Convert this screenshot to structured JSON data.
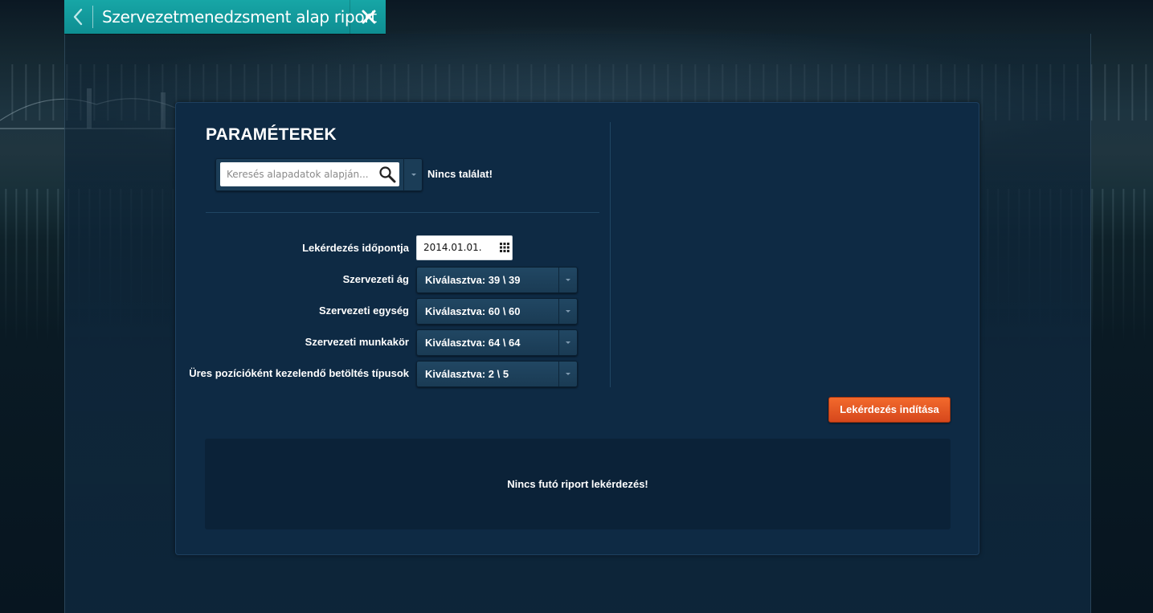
{
  "window": {
    "title": "Szervezetmenedzsment alap riport",
    "back_icon": "chevron-left-icon",
    "close_icon": "close-icon",
    "accent_color": "#129a9c"
  },
  "panel": {
    "title": "PARAMÉTEREK",
    "search": {
      "placeholder": "Keresés alapadatok alapján...",
      "value": "",
      "icon": "search-icon",
      "result_text": "Nincs találat!"
    },
    "fields": [
      {
        "label": "Lekérdezés időpontja",
        "type": "date",
        "value": "2014.01.01."
      },
      {
        "label": "Szervezeti ág",
        "type": "select",
        "value": "Kiválasztva: 39 \\ 39"
      },
      {
        "label": "Szervezeti egység",
        "type": "select",
        "value": "Kiválasztva: 60 \\ 60"
      },
      {
        "label": "Szervezeti munkakör",
        "type": "select",
        "value": "Kiválasztva: 64 \\ 64"
      },
      {
        "label": "Üres pozícióként kezelendő betöltés típusok",
        "type": "select",
        "value": "Kiválasztva: 2 \\ 5"
      }
    ],
    "run_button": {
      "label": "Lekérdezés indítása",
      "color": "#e85a24"
    },
    "status_text": "Nincs futó riport lekérdezés!"
  }
}
